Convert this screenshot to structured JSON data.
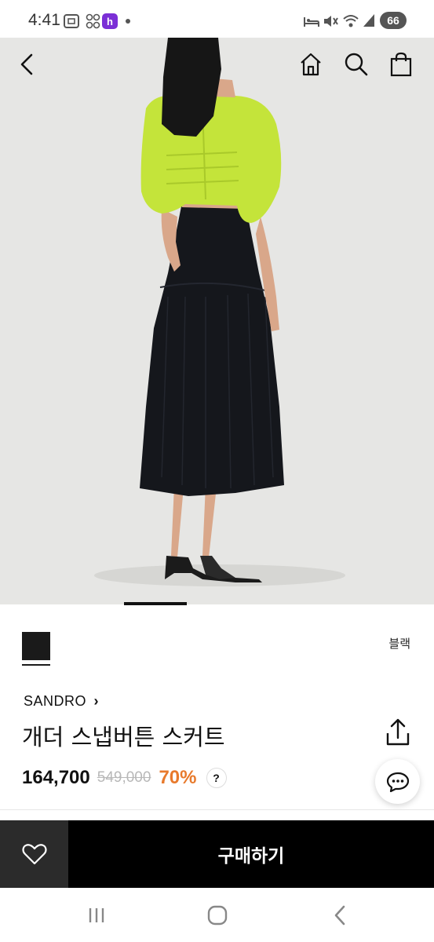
{
  "status_bar": {
    "time": "4:41",
    "battery": "66",
    "left_icons": [
      "screenshot-icon",
      "qr-icon",
      "app-notification-icon",
      "dot-icon"
    ],
    "right_icons": [
      "bed-icon",
      "mute-icon",
      "wifi-icon",
      "signal-icon"
    ]
  },
  "header": {
    "back_icon": "chevron-left-icon",
    "home_icon": "home-icon",
    "search_icon": "search-icon",
    "bag_icon": "shopping-bag-icon"
  },
  "product": {
    "color_name": "블랙",
    "brand": "SANDRO",
    "brand_chevron": "›",
    "name": "개더 스냅버튼 스커트",
    "price": "164,700",
    "original_price": "549,000",
    "discount": "70%",
    "help": "?",
    "colors": {
      "swatch": "#1a1a1a",
      "discount": "#e87a2c",
      "image_bg": "#e6e6e4",
      "top_lime": "#c4e43a",
      "skirt": "#15171c"
    }
  },
  "actions": {
    "buy_label": "구매하기",
    "wish_icon": "heart-icon",
    "share_icon": "share-icon",
    "chat_icon": "chat-icon"
  },
  "system_nav": {
    "recents_icon": "recents-icon",
    "home_icon": "home-circle-icon",
    "back_icon": "back-icon"
  }
}
